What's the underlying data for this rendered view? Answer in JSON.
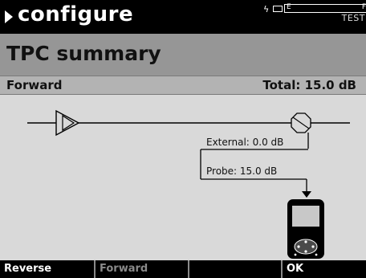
{
  "header": {
    "title": "configure",
    "status": {
      "indicator": "E",
      "indicator_right": "F",
      "mode": "TEST"
    }
  },
  "panel": {
    "title": "TPC summary"
  },
  "summary": {
    "direction": "Forward",
    "total": "Total: 15.0 dB"
  },
  "diagram": {
    "external_label": "External: 0.0 dB",
    "probe_label": "Probe: 15.0 dB"
  },
  "softkeys": [
    {
      "label": "Reverse",
      "enabled": true
    },
    {
      "label": "Forward",
      "enabled": false
    },
    {
      "label": "",
      "enabled": false
    },
    {
      "label": "OK",
      "enabled": true
    }
  ],
  "icons": [
    "play-arrow-icon",
    "lightning-icon",
    "plug-icon",
    "amplifier-icon",
    "attenuator-icon",
    "probe-device-icon"
  ]
}
